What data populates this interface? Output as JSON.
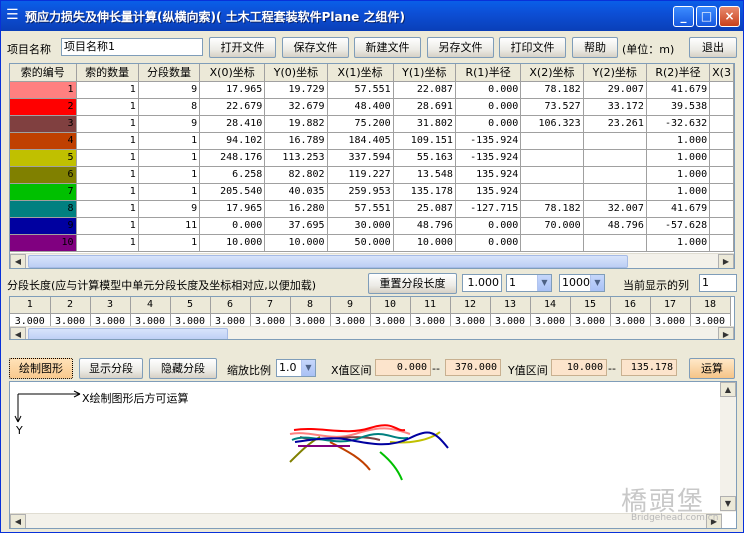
{
  "window": {
    "title": "预应力损失及伸长量计算(纵横向索)( 土木工程套装软件Plane 之组件)",
    "min_glyph": "_",
    "max_glyph": "□",
    "close_glyph": "×"
  },
  "toolbar": {
    "project_label": "项目名称",
    "project_value": "项目名称1",
    "open": "打开文件",
    "save": "保存文件",
    "new": "新建文件",
    "save_as": "另存文件",
    "print": "打印文件",
    "help": "帮助",
    "unit": "(单位：m)",
    "exit": "退出"
  },
  "cable_table": {
    "headers": [
      "索的编号",
      "索的数量",
      "分段数量",
      "X(0)坐标",
      "Y(0)坐标",
      "X(1)坐标",
      "Y(1)坐标",
      "R(1)半径",
      "X(2)坐标",
      "Y(2)坐标",
      "R(2)半径",
      "X(3"
    ],
    "rows": [
      {
        "color": "#FF8080",
        "cells": [
          "1",
          "1",
          "9",
          "17.965",
          "19.729",
          "57.551",
          "22.087",
          "0.000",
          "78.182",
          "29.007",
          "41.679"
        ]
      },
      {
        "color": "#FF0000",
        "cells": [
          "2",
          "1",
          "8",
          "22.679",
          "32.679",
          "48.400",
          "28.691",
          "0.000",
          "73.527",
          "33.172",
          "39.538"
        ]
      },
      {
        "color": "#804040",
        "cells": [
          "3",
          "1",
          "9",
          "28.410",
          "19.882",
          "75.200",
          "31.802",
          "0.000",
          "106.323",
          "23.261",
          "-32.632"
        ]
      },
      {
        "color": "#C04000",
        "cells": [
          "4",
          "1",
          "1",
          "94.102",
          "16.789",
          "184.405",
          "109.151",
          "-135.924",
          "",
          "",
          "1.000"
        ]
      },
      {
        "color": "#C0C000",
        "cells": [
          "5",
          "1",
          "1",
          "248.176",
          "113.253",
          "337.594",
          "55.163",
          "-135.924",
          "",
          "",
          "1.000"
        ]
      },
      {
        "color": "#808000",
        "cells": [
          "6",
          "1",
          "1",
          "6.258",
          "82.802",
          "119.227",
          "13.548",
          "135.924",
          "",
          "",
          "1.000"
        ]
      },
      {
        "color": "#00C000",
        "cells": [
          "7",
          "1",
          "1",
          "205.540",
          "40.035",
          "259.953",
          "135.178",
          "135.924",
          "",
          "",
          "1.000"
        ]
      },
      {
        "color": "#008080",
        "cells": [
          "8",
          "1",
          "9",
          "17.965",
          "16.280",
          "57.551",
          "25.087",
          "-127.715",
          "78.182",
          "32.007",
          "41.679"
        ]
      },
      {
        "color": "#0000A0",
        "cells": [
          "9",
          "1",
          "11",
          "0.000",
          "37.695",
          "30.000",
          "48.796",
          "0.000",
          "70.000",
          "48.796",
          "-57.628"
        ]
      },
      {
        "color": "#800080",
        "cells": [
          "10",
          "1",
          "1",
          "10.000",
          "10.000",
          "50.000",
          "10.000",
          "0.000",
          "",
          "",
          "1.000"
        ]
      }
    ]
  },
  "segment_bar": {
    "label": "分段长度(应与计算模型中单元分段长度及坐标相对应,以便加载)",
    "reset": "重置分段长度",
    "length_value": "1.000",
    "select1": "1",
    "select2": "1000",
    "current_col_label": "当前显示的列",
    "current_col_value": "1"
  },
  "segment_table": {
    "headers": [
      "1",
      "2",
      "3",
      "4",
      "5",
      "6",
      "7",
      "8",
      "9",
      "10",
      "11",
      "12",
      "13",
      "14",
      "15",
      "16",
      "17",
      "18"
    ],
    "values": [
      "3.000",
      "3.000",
      "3.000",
      "3.000",
      "3.000",
      "3.000",
      "3.000",
      "3.000",
      "3.000",
      "3.000",
      "3.000",
      "3.000",
      "3.000",
      "3.000",
      "3.000",
      "3.000",
      "3.000",
      "3.000"
    ]
  },
  "draw_bar": {
    "draw": "绘制图形",
    "show_segments": "显示分段",
    "hide_segments": "隐藏分段",
    "scale_label": "缩放比例",
    "scale_value": "1.0",
    "x_range_label": "X值区间",
    "x_min": "0.000",
    "x_max": "370.000",
    "dash": "--",
    "y_range_label": "Y值区间",
    "y_min": "10.000",
    "y_max": "135.178",
    "compute": "运算"
  },
  "canvas": {
    "axis_x_label": "X",
    "axis_y_label": "Y",
    "hint": "绘制图形后方可运算",
    "watermark": "橋頭堡",
    "watermark_sub": "Bridgehead.com.cn"
  }
}
